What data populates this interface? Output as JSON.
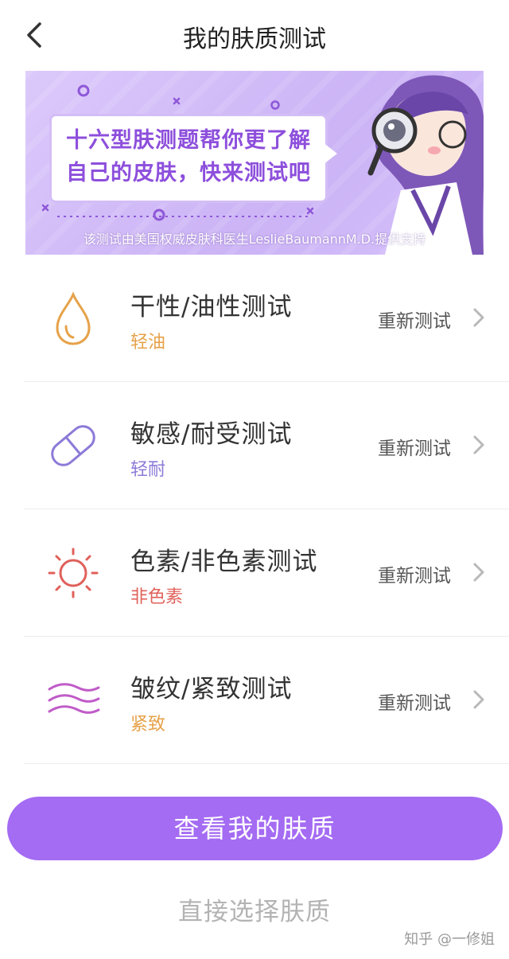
{
  "header": {
    "title": "我的肤质测试"
  },
  "banner": {
    "headline_line1": "十六型肤测题帮你更了解",
    "headline_line2": "自己的皮肤，快来测试吧",
    "caption": "该测试由美国权威皮肤科医生LeslieBaumannM.D.提供支持"
  },
  "tests": [
    {
      "title": "干性/油性测试",
      "result": "轻油",
      "result_color": "#e6a24a",
      "action": "重新测试",
      "icon": "water-drop-icon"
    },
    {
      "title": "敏感/耐受测试",
      "result": "轻耐",
      "result_color": "#8d7ad8",
      "action": "重新测试",
      "icon": "capsule-icon"
    },
    {
      "title": "色素/非色素测试",
      "result": "非色素",
      "result_color": "#e0605a",
      "action": "重新测试",
      "icon": "sun-icon"
    },
    {
      "title": "皱纹/紧致测试",
      "result": "紧致",
      "result_color": "#e6a24a",
      "action": "重新测试",
      "icon": "waves-icon"
    }
  ],
  "primary_button": {
    "label": "查看我的肤质"
  },
  "secondary_link": {
    "label": "直接选择肤质"
  },
  "watermark": "知乎 @一修姐",
  "colors": {
    "accent": "#a46bf3",
    "banner_bg": "#d3bdf6"
  }
}
